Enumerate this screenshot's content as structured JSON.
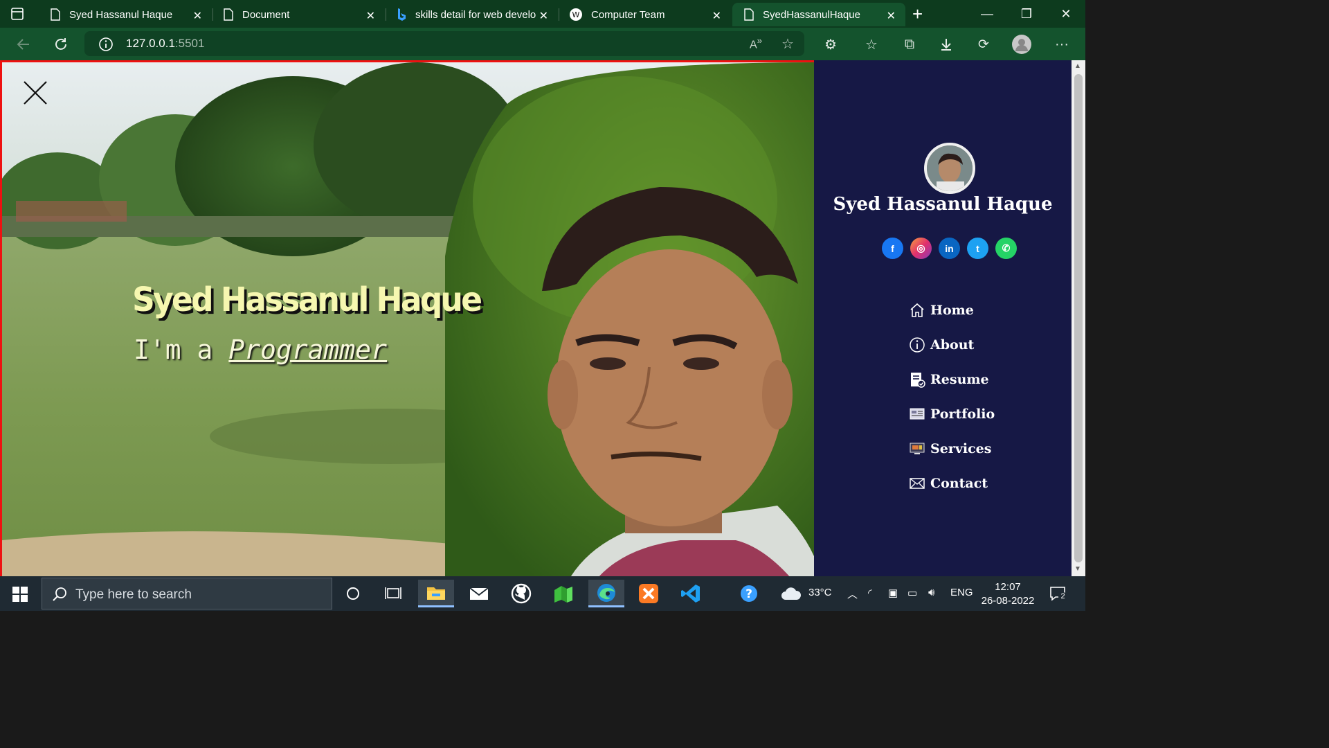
{
  "browser": {
    "tabs": [
      {
        "title": "Syed Hassanul Haque",
        "icon": "page-icon",
        "active": false
      },
      {
        "title": "Document",
        "icon": "page-icon",
        "active": false
      },
      {
        "title": "skills detail for web develo",
        "icon": "bing-icon",
        "active": false
      },
      {
        "title": "Computer Team",
        "icon": "w-logo-icon",
        "active": false
      },
      {
        "title": "SyedHassanulHaque",
        "icon": "page-icon",
        "active": true
      }
    ],
    "url_host": "127.0.0.1",
    "url_port": ":5501"
  },
  "hero": {
    "title": "Syed Hassanul Haque",
    "prefix": "I'm a",
    "role": "Programmer"
  },
  "sidebar": {
    "name": "Syed Hassanul Haque",
    "socials": [
      {
        "name": "facebook",
        "glyph": "f",
        "color": "#1877f2"
      },
      {
        "name": "instagram",
        "glyph": "◎",
        "color": "#e1306c"
      },
      {
        "name": "linkedin",
        "glyph": "in",
        "color": "#0a66c2"
      },
      {
        "name": "twitter",
        "glyph": "t",
        "color": "#1da1f2"
      },
      {
        "name": "whatsapp",
        "glyph": "✆",
        "color": "#25d366"
      }
    ],
    "nav": [
      {
        "label": "Home",
        "icon": "home-icon"
      },
      {
        "label": "About",
        "icon": "info-icon"
      },
      {
        "label": "Resume",
        "icon": "resume-icon"
      },
      {
        "label": "Portfolio",
        "icon": "portfolio-icon"
      },
      {
        "label": "Services",
        "icon": "services-icon"
      },
      {
        "label": "Contact",
        "icon": "envelope-icon"
      }
    ]
  },
  "taskbar": {
    "search_placeholder": "Type here to search",
    "weather": "33°C",
    "language": "ENG",
    "time": "12:07",
    "date": "26-08-2022",
    "notifications": "2"
  },
  "colors": {
    "tabstrip": "#0d3b1e",
    "toolbar": "#14532d",
    "sidebar": "#161845",
    "hero_title": "#f6f7b0"
  }
}
